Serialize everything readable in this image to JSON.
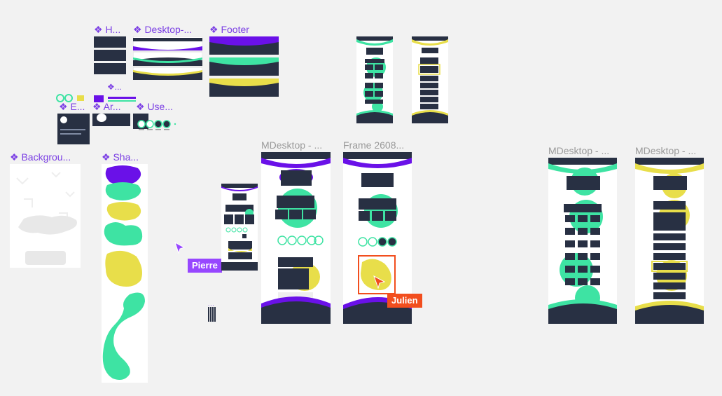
{
  "labels": {
    "h": "❖ H...",
    "desktop": "❖ Desktop-...",
    "footer": "❖ Footer",
    "e": "❖ E...",
    "ar": "❖ Ar...",
    "use": "❖ Use...",
    "small_top": "❖...",
    "background": "❖ Backgrou...",
    "shapes": "❖ Sha...",
    "mdesktop1": "MDesktop - ...",
    "frame2608": "Frame 2608...",
    "mdesktop2": "MDesktop - ...",
    "mdesktop3": "MDesktop - ...",
    "dots": "..."
  },
  "collaborators": [
    {
      "name": "Pierre",
      "color": "#9747ff"
    },
    {
      "name": "Julien",
      "color": "#f24e1e"
    }
  ],
  "colors": {
    "purple": "#6a11e8",
    "green": "#3ee3a3",
    "yellow": "#e8de4a",
    "navy": "#283043",
    "canvas": "#f2f2f2",
    "component_label": "#7b3fe4",
    "frame_label": "#9a9a9a"
  },
  "icons": {
    "component": "component-icon",
    "cursor": "cursor-arrow-icon"
  }
}
